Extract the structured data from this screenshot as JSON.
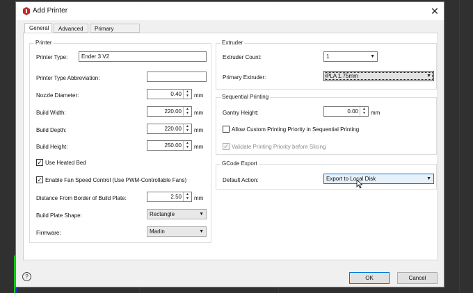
{
  "window": {
    "title": "Add Printer"
  },
  "tabs": [
    {
      "label": "General",
      "active": true
    },
    {
      "label": "Advanced",
      "active": false
    },
    {
      "label": "Primary Extruder",
      "active": false
    }
  ],
  "printer": {
    "group_title": "Printer",
    "type_label": "Printer Type:",
    "type_value": "Ender 3 V2",
    "abbrev_label": "Printer Type Abbreviation:",
    "abbrev_value": "",
    "nozzle_label": "Nozzle Diameter:",
    "nozzle_value": "0.40",
    "width_label": "Build Width:",
    "width_value": "220.00",
    "depth_label": "Build Depth:",
    "depth_value": "220.00",
    "height_label": "Build Height:",
    "height_value": "250.00",
    "unit": "mm",
    "heated_bed_label": "Use Heated Bed",
    "heated_bed_checked": true,
    "fan_speed_label": "Enable Fan Speed Control (Use PWM-Controllable Fans)",
    "fan_speed_checked": true,
    "border_distance_label": "Distance From Border of Build Plate:",
    "border_distance_value": "2.50",
    "plate_shape_label": "Build Plate Shape:",
    "plate_shape_value": "Rectangle",
    "firmware_label": "Firmware:",
    "firmware_value": "Marlin"
  },
  "extruder": {
    "group_title": "Extruder",
    "count_label": "Extruder Count:",
    "count_value": "1",
    "primary_label": "Primary Extruder:",
    "primary_value": "PLA 1.75mm"
  },
  "sequential": {
    "group_title": "Sequential Printing",
    "gantry_label": "Gantry Height:",
    "gantry_value": "0.00",
    "unit": "mm",
    "custom_priority_label": "Allow Custom Printing Priority in Sequential Printing",
    "custom_priority_checked": false,
    "validate_label": "Validate Printing Priority before Slicing",
    "validate_checked": true,
    "validate_enabled": false
  },
  "gcode": {
    "group_title": "GCode Export",
    "default_action_label": "Default Action:",
    "default_action_value": "Export to Local Disk"
  },
  "buttons": {
    "help": "?",
    "ok": "OK",
    "cancel": "Cancel"
  },
  "icons": {
    "app": "app-hexagon-icon",
    "close": "close-icon",
    "dropdown": "chevron-down-icon",
    "spin_up": "spin-up-icon",
    "spin_down": "spin-down-icon",
    "cursor": "mouse-pointer-icon"
  },
  "colors": {
    "accent": "#0078d7",
    "app_icon": "#c62828"
  }
}
